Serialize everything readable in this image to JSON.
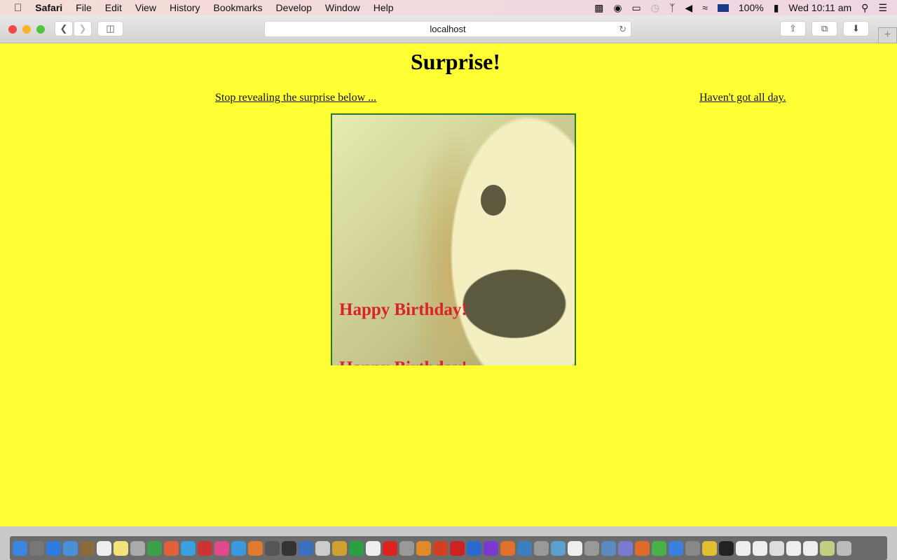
{
  "menubar": {
    "app": "Safari",
    "items": [
      "File",
      "Edit",
      "View",
      "History",
      "Bookmarks",
      "Develop",
      "Window",
      "Help"
    ],
    "status": {
      "battery": "100%",
      "clock": "Wed 10:11 am"
    }
  },
  "browser": {
    "url": "localhost"
  },
  "page": {
    "title": "Surprise!",
    "link_left": "Stop revealing the surprise below ...",
    "link_right": "Haven't got all day.",
    "card_text_1": "Happy Birthday!",
    "card_text_2": "Happy Birthday!"
  },
  "colors": {
    "page_bg": "#ffff33",
    "card_border": "#2c7a1f",
    "card_text": "#d9222a"
  },
  "dock": {
    "icon_colors": [
      "#3a86e0",
      "#777",
      "#2d7de0",
      "#4a90d9",
      "#8a6a3a",
      "#eee",
      "#f4e27a",
      "#aaa",
      "#3ba04a",
      "#e0603a",
      "#3aa0e0",
      "#c33",
      "#e04a8a",
      "#3a9ae0",
      "#e07a30",
      "#555",
      "#333",
      "#3a70c0",
      "#ccc",
      "#d0a030",
      "#2aa040",
      "#eee",
      "#d22",
      "#999",
      "#e08a2a",
      "#d04020",
      "#c22",
      "#2a6ad0",
      "#7a3ad0",
      "#e0702a",
      "#3a80c0",
      "#999",
      "#5aa0d0",
      "#eee",
      "#999",
      "#5a8ac0",
      "#7a7ad0",
      "#e06a2a",
      "#4ab04a",
      "#3a80e0",
      "#888",
      "#e0c030",
      "#222",
      "#eee",
      "#eee",
      "#ddd",
      "#eee",
      "#eee",
      "#c0d080",
      "#bbb"
    ]
  }
}
